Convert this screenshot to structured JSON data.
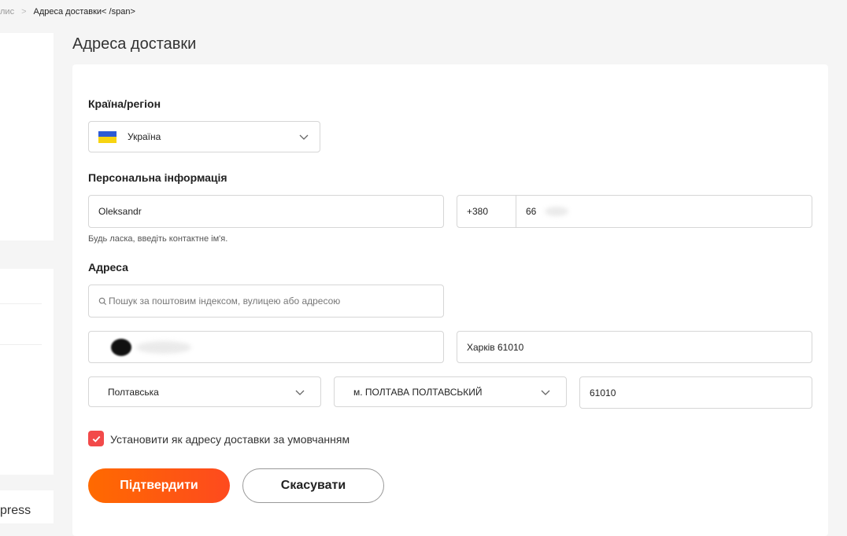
{
  "breadcrumb": {
    "parent": "лис",
    "separator": ">",
    "current": "Адреса доставки< /span>"
  },
  "sidebar": {
    "bottom_text": "press"
  },
  "page": {
    "title": "Адреса доставки"
  },
  "form": {
    "country": {
      "label": "Країна/регіон",
      "value": "Україна",
      "flag_colors": [
        "#2d5bd6",
        "#f7d411"
      ]
    },
    "personal": {
      "label": "Персональна інформація",
      "name_value": "Oleksandr",
      "name_hint": "Будь ласка, введіть контактне ім'я.",
      "phone_code": "+380",
      "phone_value": "66"
    },
    "address": {
      "label": "Адреса",
      "search_placeholder": "Пошук за поштовим індексом, вулицею або адресою",
      "street_value": "",
      "city_value": "Харків 61010",
      "region_value": "Полтавська",
      "locality_value": "м. ПОЛТАВА ПОЛТАВСЬКИЙ",
      "postal_value": "61010"
    },
    "default_checkbox": {
      "checked": true,
      "label": "Установити як адресу доставки за умовчанням"
    },
    "buttons": {
      "confirm": "Підтвердити",
      "cancel": "Скасувати"
    }
  },
  "colors": {
    "accent": "#fe4a1e",
    "checkbox": "#f24a4a"
  }
}
